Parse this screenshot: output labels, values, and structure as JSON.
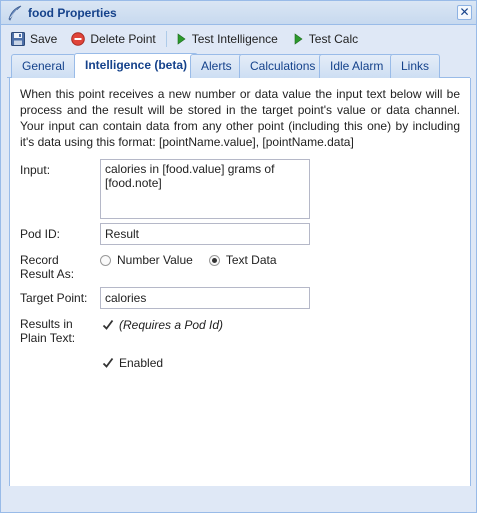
{
  "window": {
    "title": "food Properties",
    "close_glyph": "✕"
  },
  "toolbar": {
    "save": "Save",
    "delete": "Delete Point",
    "test_intelligence": "Test Intelligence",
    "test_calc": "Test Calc"
  },
  "tabs": [
    {
      "label": "General"
    },
    {
      "label": "Intelligence (beta)",
      "active": true
    },
    {
      "label": "Alerts"
    },
    {
      "label": "Calculations"
    },
    {
      "label": "Idle Alarm"
    },
    {
      "label": "Links"
    }
  ],
  "intro": "When this point receives a new number or data value the input text below will be process and the result will be stored in the target point's value or data channel. Your input can contain data from any other point (including this one) by including it's data using this format: [pointName.value], [pointName.data]",
  "form": {
    "input_label": "Input:",
    "input_value": "calories in [food.value] grams of [food.note]",
    "pod_id_label": "Pod ID:",
    "pod_id_value": "Result",
    "record_label_1": "Record",
    "record_label_2": "Result As:",
    "record_options": [
      "Number Value",
      "Text Data"
    ],
    "record_selected": "Text Data",
    "target_label": "Target Point:",
    "target_value": "calories",
    "plain_label_1": "Results in",
    "plain_label_2": "Plain Text:",
    "plain_checkbox_label": "(Requires a Pod Id)",
    "plain_checked": true,
    "enabled_label": "Enabled",
    "enabled_checked": true
  },
  "colors": {
    "accent": "#15428b",
    "border": "#99bbe8",
    "frame": "#dfe8f6",
    "delete_icon": "#e0443a",
    "play_icon": "#2c9a2c"
  }
}
